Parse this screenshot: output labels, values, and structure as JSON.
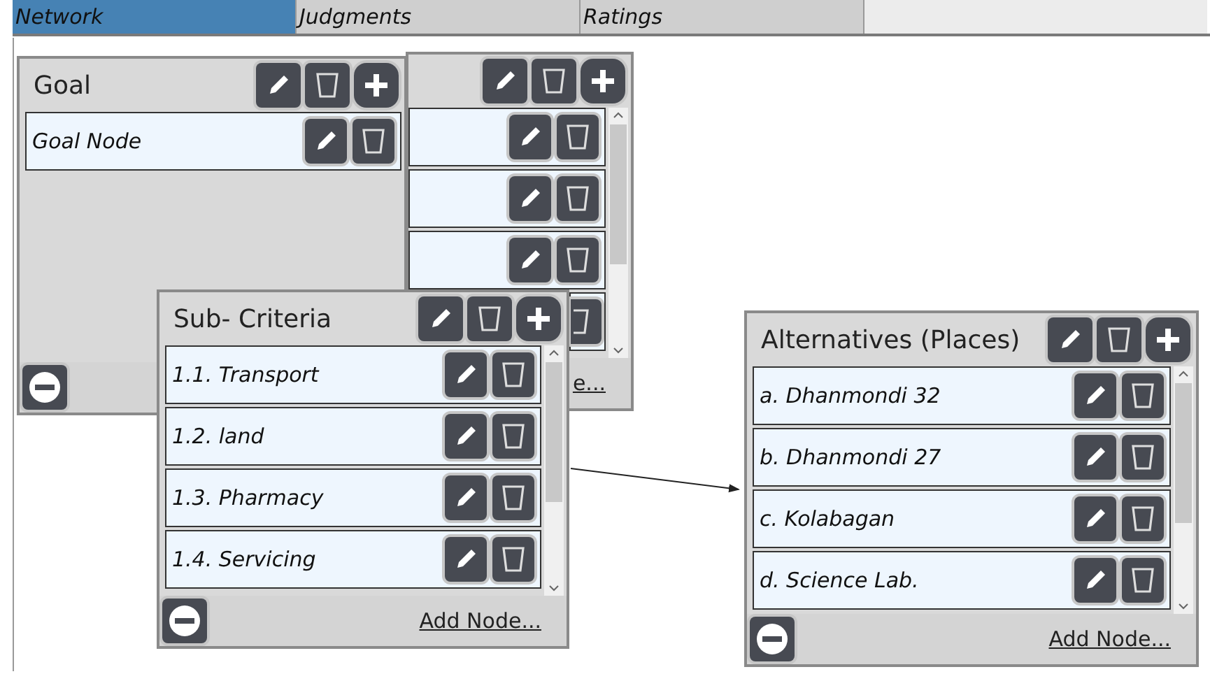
{
  "tabs": [
    {
      "label": "Network",
      "selected": true
    },
    {
      "label": "Judgments",
      "selected": false
    },
    {
      "label": "Ratings",
      "selected": false
    }
  ],
  "clusters": [
    {
      "nodes": [
        {
          "kind": "covered"
        },
        {
          "kind": "covered"
        },
        {
          "kind": "covered"
        },
        {
          "kind": "partial"
        }
      ],
      "scrollbar": true,
      "remove_button": false,
      "add_link": "e..."
    },
    {
      "title": "Goal",
      "nodes": [
        {
          "kind": "node",
          "name": "Goal Node"
        }
      ],
      "scrollbar": false,
      "remove_button": true
    },
    {
      "title": "Sub- Criteria",
      "nodes": [
        {
          "kind": "node",
          "name": "1.1. Transport"
        },
        {
          "kind": "node",
          "name": "1.2. land"
        },
        {
          "kind": "node",
          "name": "1.3. Pharmacy"
        },
        {
          "kind": "node",
          "name": "1.4. Servicing"
        }
      ],
      "scrollbar": true,
      "remove_button": true,
      "add_link": "Add Node..."
    },
    {
      "title": "Alternatives (Places)",
      "nodes": [
        {
          "kind": "node",
          "name": "a. Dhanmondi 32"
        },
        {
          "kind": "node",
          "name": "b. Dhanmondi 27"
        },
        {
          "kind": "node",
          "name": "c. Kolabagan"
        },
        {
          "kind": "node",
          "name": "d. Science Lab."
        }
      ],
      "scrollbar": true,
      "remove_button": true,
      "add_link": "Add Node..."
    }
  ]
}
